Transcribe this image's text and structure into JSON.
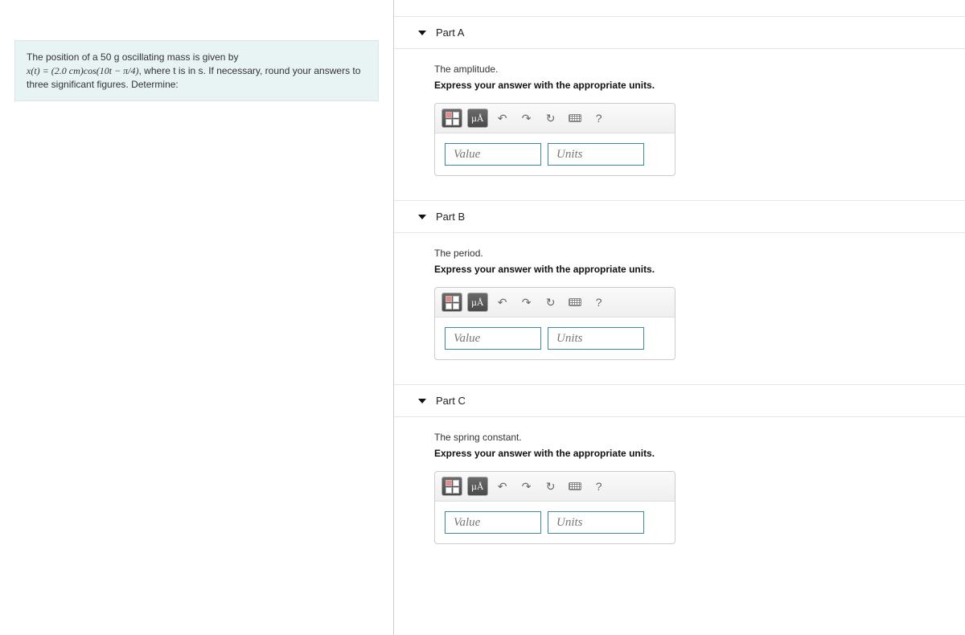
{
  "question": {
    "line1": "The position of a 50 g oscillating mass is given by",
    "eq_lhs": "x(t)",
    "eq_eq": " = ",
    "eq_rhs": "(2.0 cm)cos(10t − π/4)",
    "line2_tail": ", where t is in s. If necessary, round your answers to three significant figures. Determine:"
  },
  "instr": "Express your answer with the appropriate units.",
  "value_ph": "Value",
  "units_ph": "Units",
  "mu_label": "µÅ",
  "parts": {
    "a": {
      "title": "Part A",
      "prompt": "The amplitude."
    },
    "b": {
      "title": "Part B",
      "prompt": "The period."
    },
    "c": {
      "title": "Part C",
      "prompt": "The spring constant."
    }
  }
}
